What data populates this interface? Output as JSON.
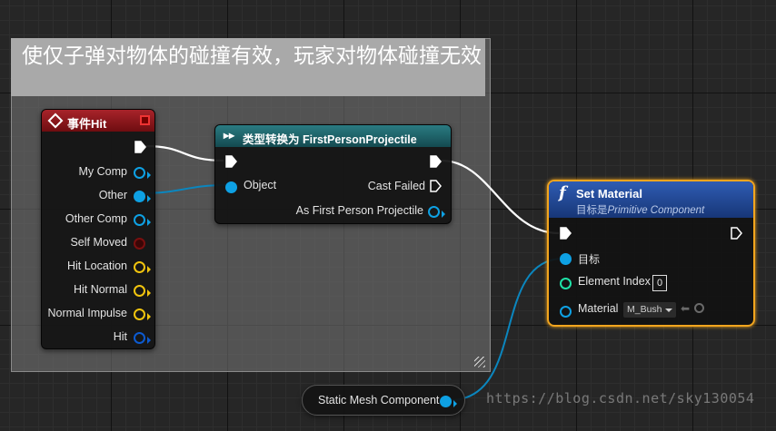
{
  "comment": {
    "title": "使仅子弹对物体的碰撞有效，玩家对物体碰撞无效"
  },
  "event_hit": {
    "title": "事件Hit",
    "pins": [
      "My Comp",
      "Other",
      "Other Comp",
      "Self Moved",
      "Hit Location",
      "Hit Normal",
      "Normal Impulse",
      "Hit"
    ]
  },
  "cast_node": {
    "title": "类型转换为 FirstPersonProjectile",
    "input_object": "Object",
    "cast_failed": "Cast Failed",
    "as_output": "As First Person Projectile"
  },
  "set_material": {
    "title": "Set Material",
    "subtitle_prefix": "目标是",
    "subtitle_target": "Primitive Component",
    "pin_target": "目标",
    "pin_element_index": "Element Index",
    "element_index_value": "0",
    "pin_material": "Material",
    "material_value": "M_Bush"
  },
  "static_mesh": {
    "label": "Static Mesh Component"
  },
  "watermark": "https://blog.csdn.net/sky130054",
  "colors": {
    "event_header": "#8c1418",
    "cast_header": "#1b5a60",
    "function_header": "#1d3f88",
    "object_pin": "#0ea1e4",
    "struct_pin": "#f1c40e",
    "bool_pin": "#7a0f0f",
    "int_pin": "#1fe3a8",
    "selected_outline": "#f2a51e"
  }
}
